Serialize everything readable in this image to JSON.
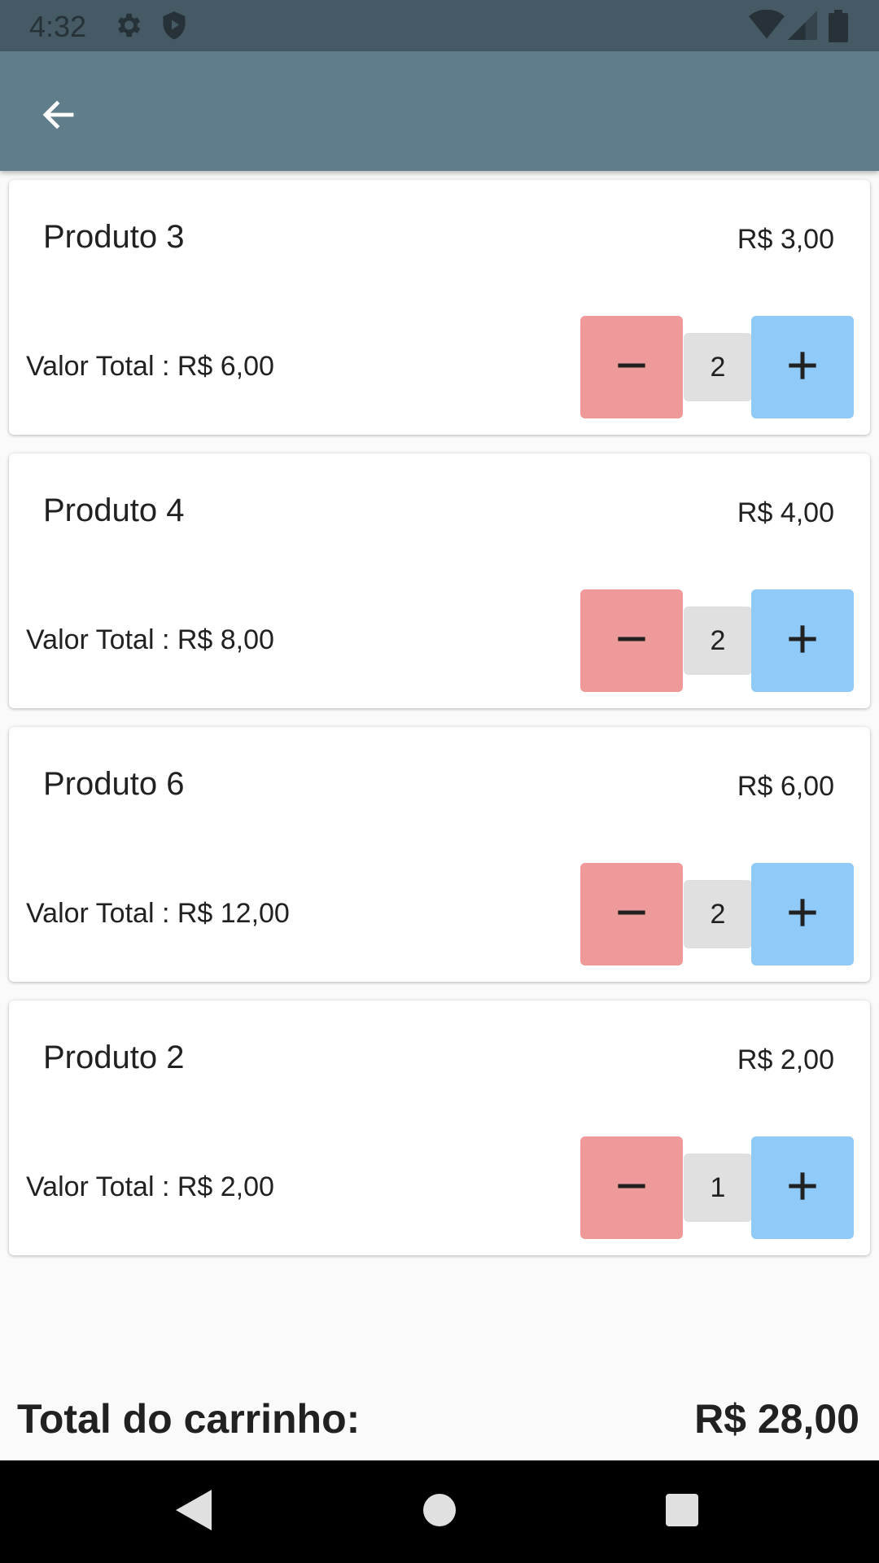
{
  "status_bar": {
    "time": "4:32",
    "icons": [
      "settings-icon",
      "shield-icon",
      "wifi-icon",
      "signal-icon",
      "battery-icon"
    ]
  },
  "app_bar": {
    "back_icon": "arrow-back-icon"
  },
  "cart_items": [
    {
      "name": "Produto 3",
      "price": "R$ 3,00",
      "total": "Valor Total : R$ 6,00",
      "quantity": "2"
    },
    {
      "name": "Produto 4",
      "price": "R$ 4,00",
      "total": "Valor Total : R$ 8,00",
      "quantity": "2"
    },
    {
      "name": "Produto 6",
      "price": "R$ 6,00",
      "total": "Valor Total : R$ 12,00",
      "quantity": "2"
    },
    {
      "name": "Produto 2",
      "price": "R$ 2,00",
      "total": "Valor Total : R$ 2,00",
      "quantity": "1"
    }
  ],
  "footer": {
    "label": "Total do carrinho:",
    "value": "R$ 28,00"
  },
  "colors": {
    "status_bar": "#455a64",
    "app_bar": "#607d8b",
    "minus_button": "#ef9a9a",
    "plus_button": "#90caf9",
    "quantity_box": "#e0e0e0"
  },
  "nav_bar": {
    "icons": [
      "back-triangle-icon",
      "home-circle-icon",
      "recents-square-icon"
    ]
  }
}
